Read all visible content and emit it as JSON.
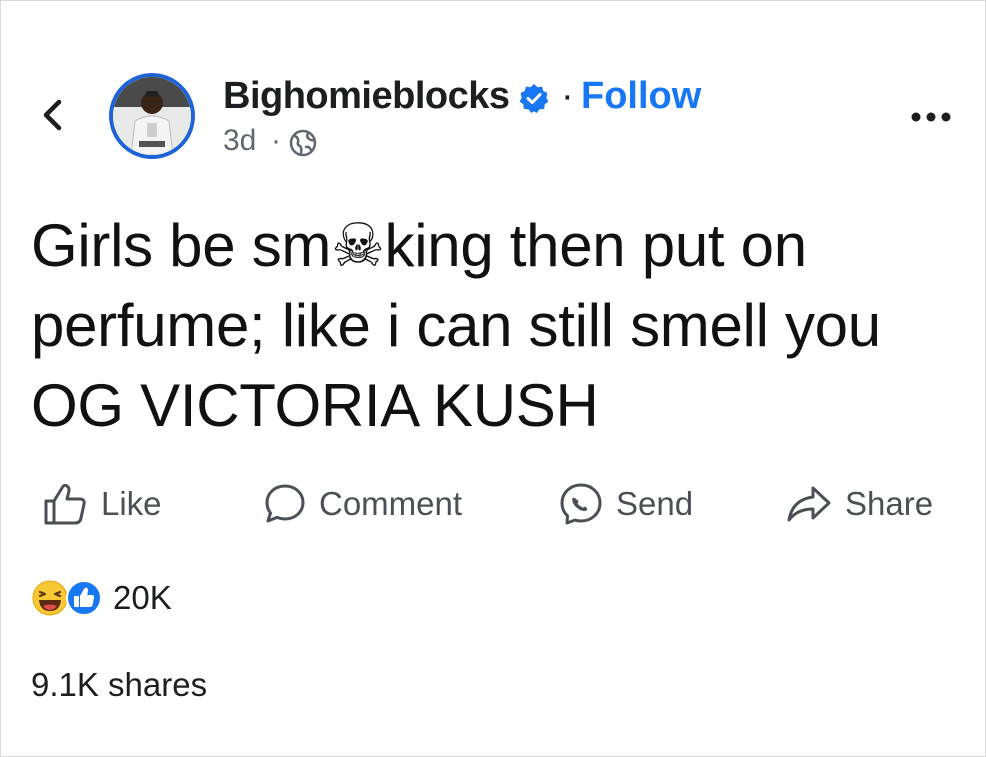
{
  "post": {
    "author": "Bighomieblocks",
    "separator": "·",
    "follow_label": "Follow",
    "time": "3d",
    "time_separator": "·",
    "text": "Girls be sm☠king then put on perfume; like i can still smell you OG VICTORIA KUSH",
    "reaction_count": "20K",
    "shares": "9.1K shares"
  },
  "actions": {
    "like": "Like",
    "comment": "Comment",
    "send": "Send",
    "share": "Share"
  },
  "colors": {
    "accent": "#1877f2",
    "avatar_ring": "#1f63d6",
    "text_primary": "#1c1e21",
    "text_secondary": "#606770"
  },
  "icons": {
    "back": "chevron-left-icon",
    "verified": "verified-badge-icon",
    "privacy": "globe-icon",
    "more": "more-dots-icon",
    "like": "thumbs-up-icon",
    "comment": "comment-bubble-icon",
    "send": "messenger-icon",
    "share": "share-arrow-icon",
    "reaction_haha": "haha-emoji-icon",
    "reaction_like": "like-reaction-icon"
  }
}
